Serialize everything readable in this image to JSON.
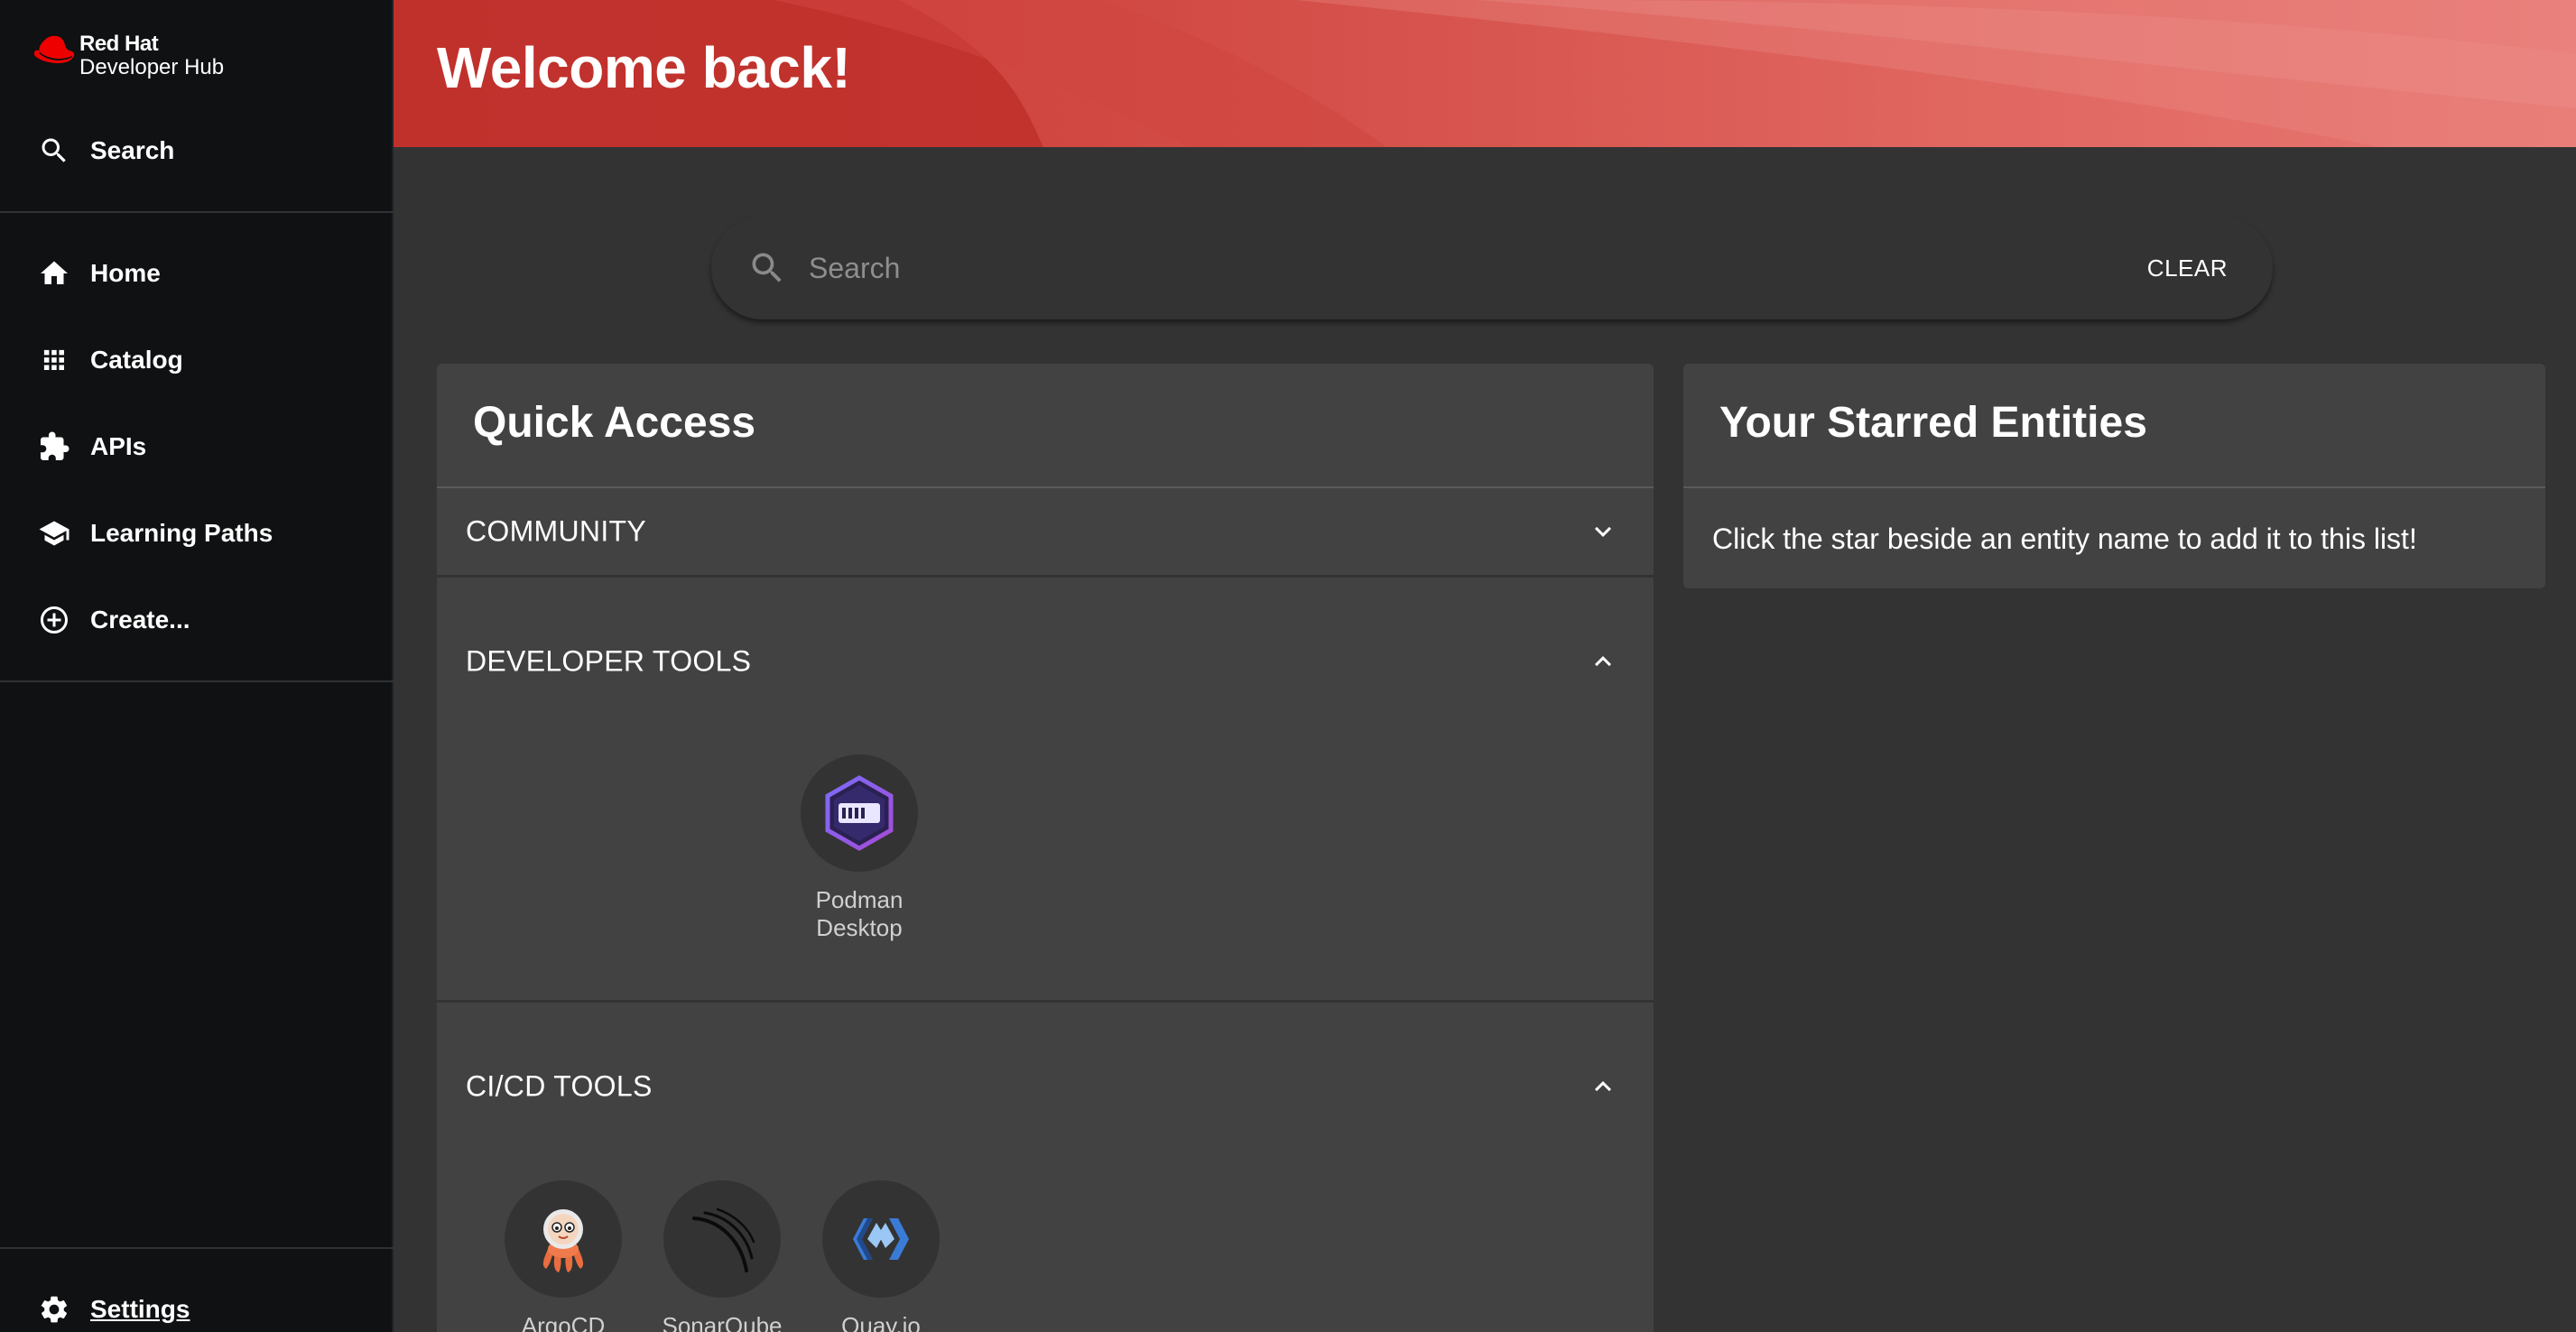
{
  "brand": {
    "line1": "Red Hat",
    "line2": "Developer Hub",
    "color": "#ee0000"
  },
  "sidebar": {
    "search": {
      "label": "Search",
      "icon": "search-icon"
    },
    "items": [
      {
        "label": "Home",
        "icon": "home-icon"
      },
      {
        "label": "Catalog",
        "icon": "catalog-grid-icon"
      },
      {
        "label": "APIs",
        "icon": "puzzle-icon"
      },
      {
        "label": "Learning Paths",
        "icon": "school-icon"
      },
      {
        "label": "Create...",
        "icon": "add-circle-icon"
      }
    ],
    "settings": {
      "label": "Settings",
      "icon": "gear-icon"
    }
  },
  "header": {
    "title": "Welcome back!"
  },
  "search": {
    "placeholder": "Search",
    "value": "",
    "clear_label": "CLEAR"
  },
  "quick_access": {
    "title": "Quick Access",
    "sections": [
      {
        "label": "COMMUNITY",
        "expanded": false,
        "tools": []
      },
      {
        "label": "DEVELOPER TOOLS",
        "expanded": true,
        "tools": [
          {
            "label": "Podman Desktop",
            "icon": "podman-desktop-icon"
          }
        ]
      },
      {
        "label": "CI/CD TOOLS",
        "expanded": true,
        "tools": [
          {
            "label": "ArgoCD",
            "icon": "argocd-icon"
          },
          {
            "label": "SonarQube",
            "icon": "sonarqube-icon"
          },
          {
            "label": "Quay.io",
            "icon": "quay-icon"
          }
        ]
      }
    ]
  },
  "starred": {
    "title": "Your Starred Entities",
    "empty_message": "Click the star beside an entity name to add it to this list!"
  },
  "colors": {
    "sidebar_bg": "#0f1113",
    "page_bg": "#333333",
    "card_bg": "#424242",
    "header_red": "#c8342f"
  }
}
